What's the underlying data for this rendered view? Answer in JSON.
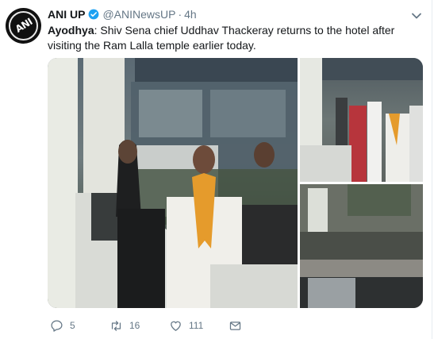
{
  "tweet": {
    "author_name": "ANI UP",
    "handle": "@ANINewsUP",
    "separator": "·",
    "time": "4h",
    "avatar_text": "ANI",
    "text_location": "Ayodhya",
    "text_body": ": Shiv Sena chief Uddhav Thackeray returns to the hotel after visiting the Ram Lalla temple earlier today."
  },
  "actions": {
    "reply_count": "5",
    "retweet_count": "16",
    "like_count": "111"
  },
  "icons": {
    "verified": "verified-badge-icon",
    "menu": "chevron-down-icon",
    "reply": "reply-icon",
    "retweet": "retweet-icon",
    "like": "heart-icon",
    "message": "envelope-icon"
  },
  "colors": {
    "name": "#14171a",
    "muted": "#657786",
    "verified": "#1da1f2",
    "border": "#e6ecf0"
  }
}
